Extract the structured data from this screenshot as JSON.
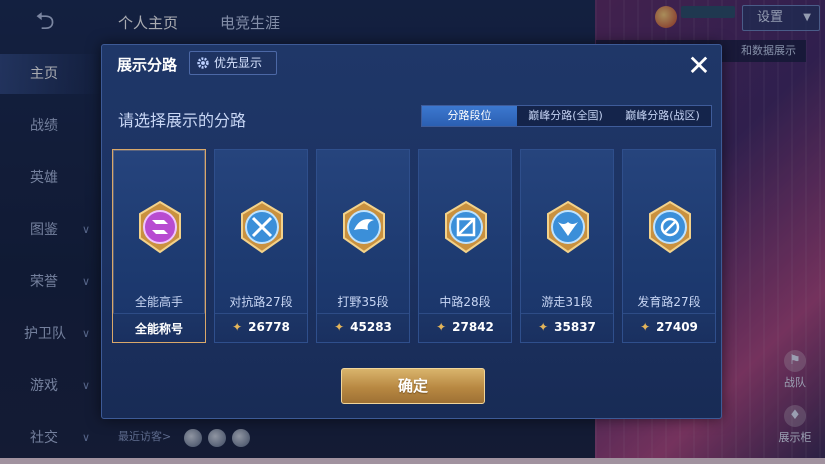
{
  "app": {
    "back_icon": "back-arrow-icon",
    "top_tabs": [
      {
        "label": "个人主页",
        "active": true
      },
      {
        "label": "电竞生涯",
        "active": false
      }
    ],
    "settings_label": "设置",
    "hint_text": "和数据展示",
    "sidebar": [
      {
        "label": "主页",
        "active": true
      },
      {
        "label": "战绩"
      },
      {
        "label": "英雄"
      },
      {
        "label": "图鉴"
      },
      {
        "label": "荣誉"
      },
      {
        "label": "护卫队"
      },
      {
        "label": "游戏"
      },
      {
        "label": "社交"
      }
    ],
    "recent_visitors": "最近访客>",
    "right_icons": [
      {
        "label": "战队",
        "icon": "team-icon"
      },
      {
        "label": "展示柜",
        "icon": "showcase-icon"
      }
    ]
  },
  "modal": {
    "title": "展示分路",
    "priority_label": "优先显示",
    "close_icon": "close-icon",
    "subtitle": "请选择展示的分路",
    "segments": [
      {
        "label": "分路段位",
        "active": true
      },
      {
        "label": "巅峰分路(全国)",
        "active": false
      },
      {
        "label": "巅峰分路(战区)",
        "active": false
      }
    ],
    "cards": [
      {
        "name": "全能高手",
        "value": "全能称号",
        "selected": true,
        "emblem": "all-round-emblem-icon",
        "color": "#b84bd1"
      },
      {
        "name": "对抗路27段",
        "value": "26778",
        "selected": false,
        "emblem": "clash-lane-emblem-icon",
        "color": "#3b8fd9"
      },
      {
        "name": "打野35段",
        "value": "45283",
        "selected": false,
        "emblem": "jungle-emblem-icon",
        "color": "#3b8fd9"
      },
      {
        "name": "中路28段",
        "value": "27842",
        "selected": false,
        "emblem": "mid-lane-emblem-icon",
        "color": "#3b8fd9"
      },
      {
        "name": "游走31段",
        "value": "35837",
        "selected": false,
        "emblem": "roam-emblem-icon",
        "color": "#3b8fd9"
      },
      {
        "name": "发育路27段",
        "value": "27409",
        "selected": false,
        "emblem": "farm-lane-emblem-icon",
        "color": "#3b8fd9"
      }
    ],
    "confirm_label": "确定"
  },
  "colors": {
    "accent_gold": "#d9b46c",
    "modal_bg": "#1f3768",
    "active_tab": "#3c78cf"
  }
}
